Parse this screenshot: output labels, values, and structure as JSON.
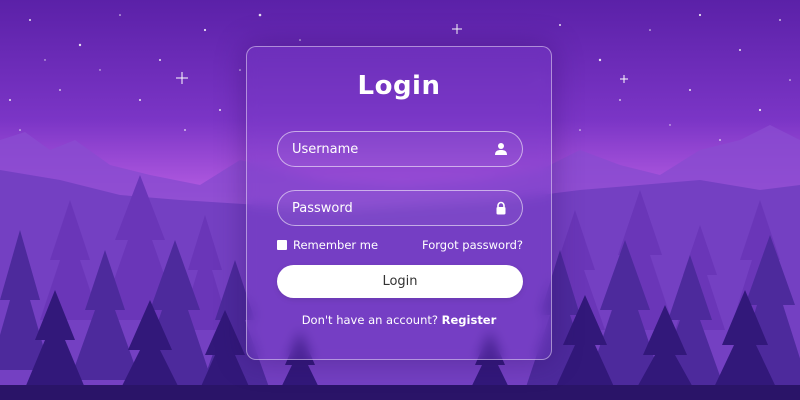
{
  "login_form": {
    "title": "Login",
    "username": {
      "placeholder": "Username",
      "value": "",
      "icon": "user-icon"
    },
    "password": {
      "placeholder": "Password",
      "value": "",
      "icon": "lock-icon"
    },
    "remember_label": "Remember me",
    "remember_checked": false,
    "forgot_label": "Forgot password?",
    "submit_label": "Login",
    "register_prompt": "Don't have an account?",
    "register_label": "Register"
  },
  "colors": {
    "sky_top": "#5a22a6",
    "horizon_glow": "#c77ae8",
    "panel_border": "#ffffff",
    "button_bg": "#ffffff",
    "text": "#ffffff"
  }
}
